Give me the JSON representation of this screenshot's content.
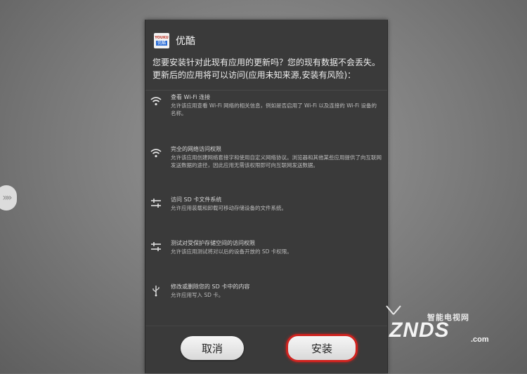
{
  "dialog": {
    "app_name": "优酷",
    "app_icon_top": "YOUKU",
    "app_icon_bottom": "优酷",
    "message": "您要安装针对此现有应用的更新吗？您的现有数据不会丢失。更新后的应用将可以访问(应用未知来源,安装有风险)：",
    "permissions": [
      {
        "icon": "wifi-icon",
        "title": "查看 Wi-Fi 连接",
        "desc": "允许该应用查看 Wi-Fi 网络的相关信息，例如是否启用了 Wi-Fi 以及连接的 Wi-Fi 设备的名称。"
      },
      {
        "icon": "wifi-icon",
        "title": "完全的网络访问权限",
        "desc": "允许该应用创建网络套接字和使用自定义网络协议。浏览器和其他某些应用提供了向互联网发送数据的途径，因此应用无需该权限即可向互联网发送数据。"
      },
      {
        "icon": "sliders-icon",
        "title": "访问 SD 卡文件系统",
        "desc": "允许应用装载和卸载可移动存储设备的文件系统。"
      },
      {
        "icon": "sliders-icon",
        "title": "测试对受保护存储空间的访问权限",
        "desc": "允许该应用测试将对以后的设备开放的 SD 卡权限。"
      },
      {
        "icon": "usb-icon",
        "title": "修改或删除您的 SD 卡中的内容",
        "desc": "允许应用写入 SD 卡。"
      }
    ],
    "cancel_label": "取消",
    "install_label": "安装"
  },
  "watermark": {
    "top": "智能电视网",
    "main": "ZNDS",
    "domain": ".com"
  },
  "side_arrow": "»»"
}
